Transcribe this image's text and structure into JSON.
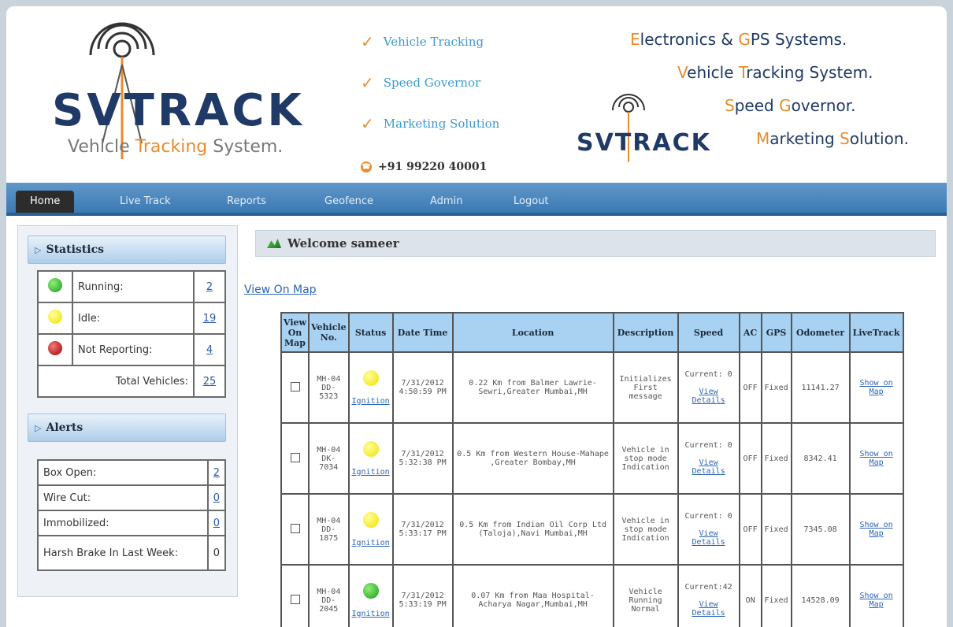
{
  "header": {
    "logo_text": "SVTRACK",
    "tagline_pre": "Vehicle ",
    "tagline_hl": "Tracking",
    "tagline_post": " System.",
    "features": [
      "Vehicle Tracking",
      "Speed Governor",
      "Marketing Solution"
    ],
    "phone": "+91 99220 40001",
    "promo": [
      {
        "pre": "",
        "o1": "E",
        "mid": "lectronics & ",
        "o2": "G",
        "rest": "PS Systems."
      },
      {
        "pre": "",
        "o1": "V",
        "mid": "ehicle ",
        "o2": "T",
        "rest": "racking System."
      },
      {
        "pre": "",
        "o1": "S",
        "mid": "peed ",
        "o2": "G",
        "rest": "overnor."
      },
      {
        "pre": "",
        "o1": "M",
        "mid": "arketing ",
        "o2": "S",
        "rest": "olution."
      }
    ],
    "logo_small_text": "SVTRACK"
  },
  "nav": {
    "items": [
      "Home",
      "Live Track",
      "Reports",
      "Geofence",
      "Admin",
      "Logout"
    ],
    "active": "Home"
  },
  "statistics": {
    "title": "Statistics",
    "rows": [
      {
        "label": "Running:",
        "count": "2",
        "color": "green"
      },
      {
        "label": "Idle:",
        "count": "19",
        "color": "yellow"
      },
      {
        "label": "Not Reporting:",
        "count": "4",
        "color": "red"
      }
    ],
    "total_label": "Total Vehicles:",
    "total_count": "25"
  },
  "alerts": {
    "title": "Alerts",
    "rows": [
      {
        "label": "Box Open:",
        "count": "2",
        "link": true
      },
      {
        "label": "Wire Cut:",
        "count": "0",
        "link": true
      },
      {
        "label": "Immobilized:",
        "count": "0",
        "link": true
      },
      {
        "label": "Harsh Brake In Last Week:",
        "count": "0",
        "link": false
      }
    ]
  },
  "main": {
    "welcome": "Welcome sameer",
    "view_on_map": "View On Map",
    "columns": [
      "View On Map",
      "Vehicle No.",
      "Status",
      "Date Time",
      "Location",
      "Description",
      "Speed",
      "AC",
      "GPS",
      "Odometer",
      "LiveTrack"
    ],
    "status_link": "Ignition",
    "speed_link": "View Details",
    "livetrack_link": "Show on Map",
    "rows": [
      {
        "vehicle": "MH-04 DD- 5323",
        "status_color": "yellow",
        "datetime": "7/31/2012 4:50:59 PM",
        "location": "0.22 Km from Balmer Lawrie-Sewri,Greater Mumbai,MH",
        "description": "Initializes First message",
        "speed": "Current: 0",
        "ac": "OFF",
        "gps": "Fixed",
        "odometer": "11141.27"
      },
      {
        "vehicle": "MH-04 DK- 7034",
        "status_color": "yellow",
        "datetime": "7/31/2012 5:32:38 PM",
        "location": "0.5 Km from Western House-Mahape ,Greater Bombay,MH",
        "description": "Vehicle in stop mode Indication",
        "speed": "Current: 0",
        "ac": "OFF",
        "gps": "Fixed",
        "odometer": "8342.41"
      },
      {
        "vehicle": "MH-04 DD- 1875",
        "status_color": "yellow",
        "datetime": "7/31/2012 5:33:17 PM",
        "location": "0.5 Km from Indian Oil Corp Ltd (Taloja),Navi Mumbai,MH",
        "description": "Vehicle in stop mode Indication",
        "speed": "Current: 0",
        "ac": "OFF",
        "gps": "Fixed",
        "odometer": "7345.08"
      },
      {
        "vehicle": "MH-04 DD- 2045",
        "status_color": "green",
        "datetime": "7/31/2012 5:33:19 PM",
        "location": "0.07 Km from Maa Hospital-Acharya Nagar,Mumbai,MH",
        "description": "Vehicle Running Normal",
        "speed": "Current:42",
        "ac": "ON",
        "gps": "Fixed",
        "odometer": "14528.09"
      }
    ]
  }
}
